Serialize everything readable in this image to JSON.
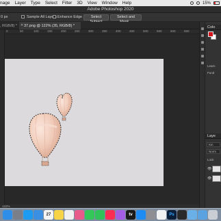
{
  "menubar": {
    "items": [
      "nage",
      "Layer",
      "Type",
      "Select",
      "Filter",
      "3D",
      "View",
      "Window",
      "Help"
    ],
    "battery": "15%"
  },
  "titlebar": {
    "title": "Adobe Photoshop 2020"
  },
  "options": {
    "left_text": "0 px",
    "sample_all_layers": "Sample All Layers",
    "enhance_edge": "Enhance Edge",
    "select_subject": "Select Subject",
    "select_and_mask": "Select and Mask..."
  },
  "tabs": {
    "prev": ", RGB/8) *",
    "active": "37.png @ 122% (35, RGB/8) *"
  },
  "ruler": {
    "marks": [
      "0",
      "50",
      "100",
      "150",
      "200",
      "250",
      "300",
      "350",
      "400",
      "450",
      "500",
      "550",
      "600",
      "650"
    ]
  },
  "status": {
    "zoom": "122%"
  },
  "panels": {
    "color_header": "Colo",
    "learn_label": "Learn",
    "learn_sub": "Fund",
    "layers_header": "Laye",
    "search_value": "Kin",
    "blend_mode": "Norm",
    "lock_label": "Lock"
  },
  "dock": {
    "items": [
      {
        "name": "finder",
        "label": "",
        "color": "#2f8fe8"
      },
      {
        "name": "launchpad",
        "label": "",
        "color": "#7a7f8a"
      },
      {
        "name": "safari",
        "label": "",
        "color": "#1c9bf0"
      },
      {
        "name": "mail",
        "label": "",
        "color": "#3a8fe2"
      },
      {
        "name": "calendar",
        "label": "27",
        "color": "#f4f4f4"
      },
      {
        "name": "notes",
        "label": "",
        "color": "#f7d347"
      },
      {
        "name": "reminders",
        "label": "",
        "color": "#f0f0f0"
      },
      {
        "name": "photos",
        "label": "",
        "color": "#e85a8a"
      },
      {
        "name": "facetime",
        "label": "",
        "color": "#33c759"
      },
      {
        "name": "messages",
        "label": "",
        "color": "#32c25a"
      },
      {
        "name": "music",
        "label": "",
        "color": "#fa2d55"
      },
      {
        "name": "podcasts",
        "label": "",
        "color": "#a45ee5"
      },
      {
        "name": "tv",
        "label": "tv",
        "color": "#1a1a1a"
      },
      {
        "name": "appstore",
        "label": "",
        "color": "#1e8cf2"
      },
      {
        "name": "settings",
        "label": "",
        "color": "#8e8e93"
      },
      {
        "name": "chrome",
        "label": "",
        "color": "#f2f2f2"
      },
      {
        "name": "photoshop",
        "label": "Ps",
        "color": "#0b1f3a"
      },
      {
        "name": "terminal",
        "label": "",
        "color": "#2a2a2a"
      },
      {
        "name": "folder",
        "label": "",
        "color": "#6ab0e8"
      },
      {
        "name": "downloads",
        "label": "",
        "color": "#5aa2e0"
      },
      {
        "name": "trash",
        "label": "",
        "color": "#c9ced4"
      }
    ]
  },
  "colors": {
    "foreground": "#d4141c",
    "background": "#ffffff",
    "canvas": "#dcdadc",
    "balloon": "#f3d2c4"
  }
}
